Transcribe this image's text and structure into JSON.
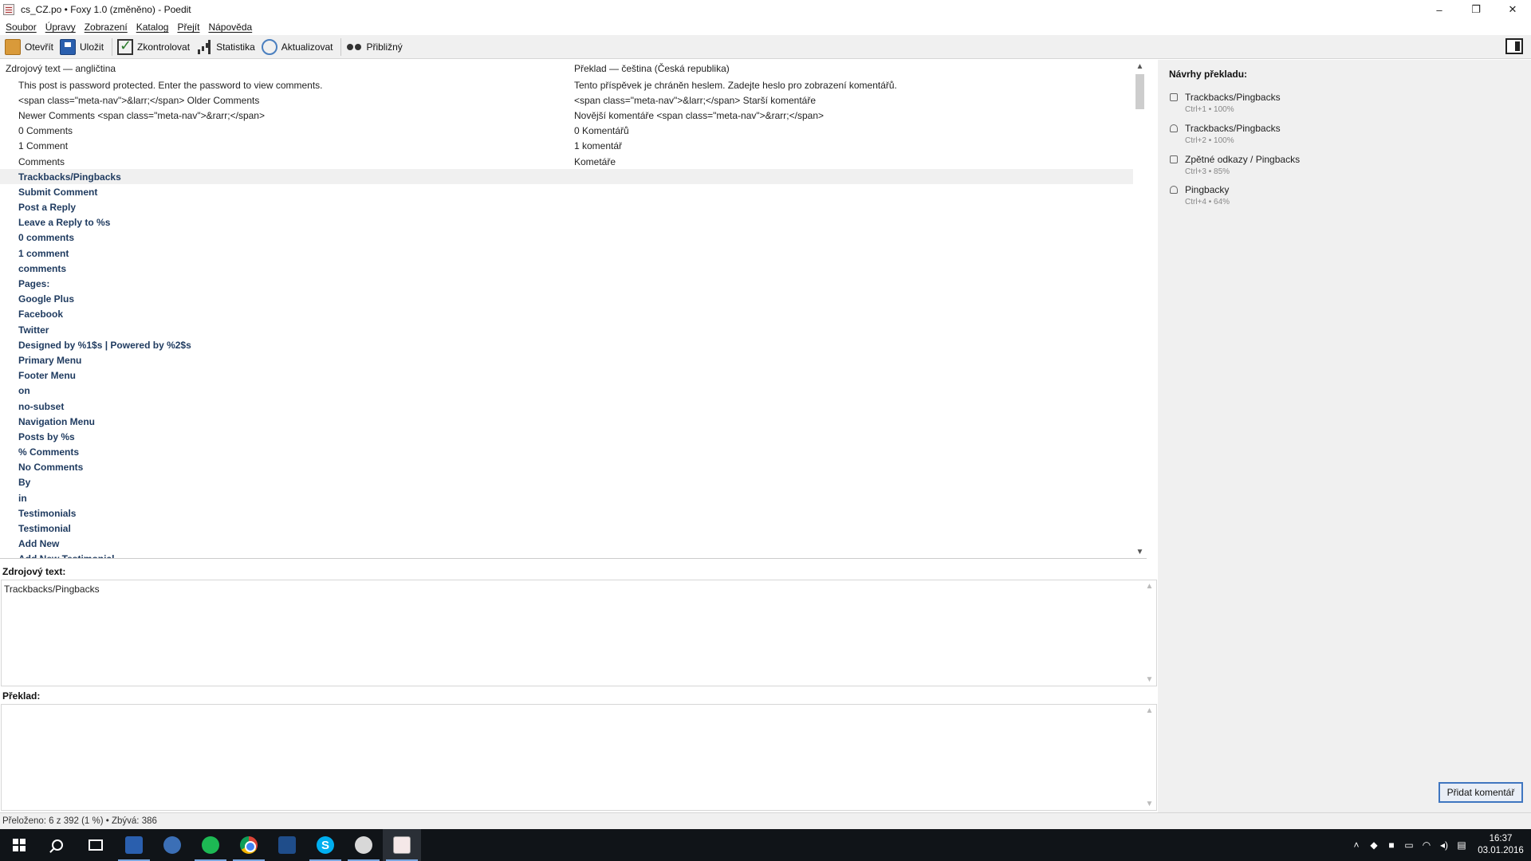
{
  "window": {
    "title": "cs_CZ.po • Foxy 1.0 (změněno) - Poedit",
    "controls": [
      "–",
      "❐",
      "✕"
    ]
  },
  "menu": [
    "Soubor",
    "Úpravy",
    "Zobrazení",
    "Katalog",
    "Přejít",
    "Nápověda"
  ],
  "toolbar": {
    "open": "Otevřít",
    "save": "Uložit",
    "validate": "Zkontrolovat",
    "stats": "Statistika",
    "update": "Aktualizovat",
    "fuzzy": "Přibližný"
  },
  "list": {
    "source_header": "Zdrojový text — angličtina",
    "translation_header": "Překlad — čeština (Česká republika)",
    "rows": [
      {
        "source": "This post is password protected. Enter the password to view comments.",
        "translation": "Tento příspěvek je chráněn heslem. Zadejte heslo pro zobrazení komentářů."
      },
      {
        "source": "<span class=\"meta-nav\">&larr;</span> Older Comments",
        "translation": "<span class=\"meta-nav\">&larr;</span> Starší komentáře"
      },
      {
        "source": "Newer Comments <span class=\"meta-nav\">&rarr;</span>",
        "translation": "Novější komentáře <span class=\"meta-nav\">&rarr;</span>"
      },
      {
        "source": "0 Comments",
        "translation": "0 Komentářů"
      },
      {
        "source": "1 Comment",
        "translation": "1 komentář"
      },
      {
        "source": "Comments",
        "translation": "Kometáře"
      },
      {
        "source": "Trackbacks/Pingbacks",
        "translation": ""
      },
      {
        "source": "Submit Comment",
        "translation": ""
      },
      {
        "source": "Post a Reply",
        "translation": ""
      },
      {
        "source": "Leave a Reply to %s",
        "translation": ""
      },
      {
        "source": "0 comments",
        "translation": ""
      },
      {
        "source": "1 comment",
        "translation": ""
      },
      {
        "source": "comments",
        "translation": ""
      },
      {
        "source": "Pages:",
        "translation": ""
      },
      {
        "source": "Google Plus",
        "translation": ""
      },
      {
        "source": "Facebook",
        "translation": ""
      },
      {
        "source": "Twitter",
        "translation": ""
      },
      {
        "source": "Designed by %1$s | Powered by %2$s",
        "translation": ""
      },
      {
        "source": "Primary Menu",
        "translation": ""
      },
      {
        "source": "Footer Menu",
        "translation": ""
      },
      {
        "source": "on",
        "translation": ""
      },
      {
        "source": "no-subset",
        "translation": ""
      },
      {
        "source": "Navigation Menu",
        "translation": ""
      },
      {
        "source": "Posts by %s",
        "translation": ""
      },
      {
        "source": "% Comments",
        "translation": ""
      },
      {
        "source": "No Comments",
        "translation": ""
      },
      {
        "source": "By",
        "translation": ""
      },
      {
        "source": "in",
        "translation": ""
      },
      {
        "source": "Testimonials",
        "translation": ""
      },
      {
        "source": "Testimonial",
        "translation": ""
      },
      {
        "source": "Add New",
        "translation": ""
      },
      {
        "source": "Add New Testimonial",
        "translation": ""
      }
    ]
  },
  "source_editor": {
    "label": "Zdrojový text:",
    "value": "Trackbacks/Pingbacks"
  },
  "translation_editor": {
    "label": "Překlad:",
    "value": ""
  },
  "suggestions": {
    "title": "Návrhy překladu:",
    "items": [
      {
        "text": "Trackbacks/Pingbacks",
        "meta": "Ctrl+1 • 100%",
        "icon": "database-icon"
      },
      {
        "text": "Trackbacks/Pingbacks",
        "meta": "Ctrl+2 • 100%",
        "icon": "person-icon"
      },
      {
        "text": "Zpětné odkazy / Pingbacks",
        "meta": "Ctrl+3 • 85%",
        "icon": "database-icon"
      },
      {
        "text": "Pingbacky",
        "meta": "Ctrl+4 • 64%",
        "icon": "person-icon"
      }
    ]
  },
  "add_comment": "Přidat komentář",
  "status": "Přeloženo: 6 z 392 (1 %)  •  Zbývá: 386",
  "clock": {
    "time": "16:37",
    "date": "03.01.2016"
  },
  "colors": {
    "accent": "#3f76c0",
    "untranslated": "#1e3a5f",
    "taskbar": "#101418"
  }
}
